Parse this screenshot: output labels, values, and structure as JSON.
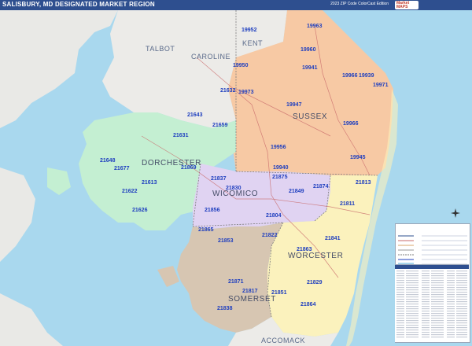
{
  "header": {
    "title": "SALISBURY, MD DESIGNATED MARKET REGION",
    "edition": "2023 ZIP Code ColorCast Edition"
  },
  "counties": [
    {
      "id": "kent",
      "label": "KENT"
    },
    {
      "id": "talbot",
      "label": "TALBOT"
    },
    {
      "id": "caroline",
      "label": "CAROLINE"
    },
    {
      "id": "sussex",
      "label": "SUSSEX"
    },
    {
      "id": "dorchester",
      "label": "DORCHESTER"
    },
    {
      "id": "wicomico",
      "label": "WICOMICO"
    },
    {
      "id": "worcester",
      "label": "WORCESTER"
    },
    {
      "id": "somerset",
      "label": "SOMERSET"
    },
    {
      "id": "accomack",
      "label": "ACCOMACK"
    }
  ],
  "zips": {
    "z19963": "19963",
    "z19952": "19952",
    "z19960": "19960",
    "z19950": "19950",
    "z19941": "19941",
    "z19966a": "19966",
    "z19939": "19939",
    "z19971": "19971",
    "z21632": "21632",
    "z19973": "19973",
    "z19947": "19947",
    "z21643": "21643",
    "z21659": "21659",
    "z19966b": "19966",
    "z21631": "21631",
    "z19956": "19956",
    "z19945": "19945",
    "z21648": "21648",
    "z21677": "21677",
    "z21869": "21869",
    "z19940": "19940",
    "z21837": "21837",
    "z21875": "21875",
    "z21813": "21813",
    "z21613": "21613",
    "z21830": "21830",
    "z21874": "21874",
    "z21622": "21622",
    "z21849": "21849",
    "z21811": "21811",
    "z21626": "21626",
    "z21856": "21856",
    "z21804": "21804",
    "z21865": "21865",
    "z21822": "21822",
    "z21841": "21841",
    "z21853": "21853",
    "z21863": "21863",
    "z21829": "21829",
    "z21871": "21871",
    "z21817": "21817",
    "z21851": "21851",
    "z21864": "21864",
    "z21838": "21838"
  }
}
